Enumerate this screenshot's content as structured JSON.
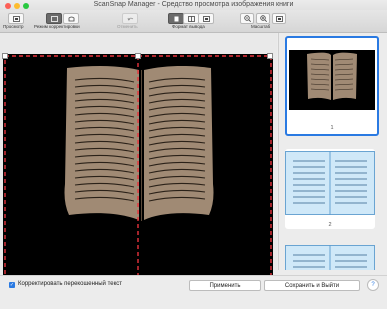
{
  "window": {
    "title": "ScanSnap Manager - Средство просмотра изображения книги"
  },
  "toolbar": {
    "preview_label": "Просмотр",
    "correction_mode_label": "Режим корректировки",
    "undo_label": "Отменить",
    "output_format_label": "Формат вывода",
    "zoom_label": "Масштаб"
  },
  "thumbnails": [
    {
      "number": "1",
      "selected": true
    },
    {
      "number": "2",
      "selected": false
    }
  ],
  "bottom": {
    "skew_checkbox_label": "Корректировать перекошенный текст",
    "skew_checked": true,
    "apply_label": "Применить",
    "save_exit_label": "Сохранить и Выйти",
    "help_label": "?"
  },
  "colors": {
    "accent": "#2a7ae2",
    "crop_line": "#e8323c",
    "book_page": "#a08a74",
    "thumb_page": "#cfe8f8"
  }
}
